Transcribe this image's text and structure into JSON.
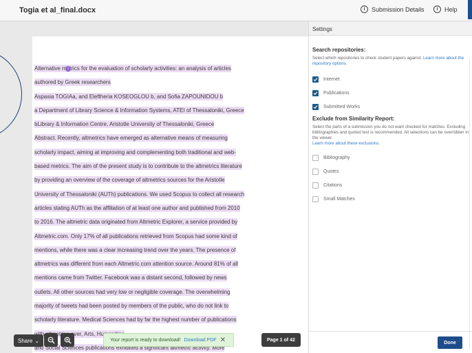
{
  "header": {
    "doc_title": "Togia et al_final.docx",
    "submission_details": "Submission Details",
    "help": "Help"
  },
  "document": {
    "marker": "1",
    "lines": [
      "Alternative metrics for the evaluation of scholarly activities: an analysis of articles",
      "authored by Greek researchers",
      "Aspasia TOGIAa, and Eleftheria KOSEOGLOU b, and Sofia ZAPOUNIDOU b",
      "a Department of Library Science & Information Systems, ATEI of Thessaloniki, Greece",
      "bLibrary & Information Centre, Aristotle University of Thessaloniki, Greece",
      "Abstract. Recently, altmetrics have emerged as alternative means of measuring",
      "scholarly impact, aiming at improving and complementing both traditional and web-",
      "based metrics. The aim of the present study is to contribute to the altmetrics literature",
      "by providing an overview of the coverage of altmetrics sources for the Aristotle",
      "University of Thessaloniki (AUTh) publications. We used Scopus to collect all research",
      "articles stating AUTh as the affiliation of at least one author and published from 2010",
      "to 2016. The altmetric data originated from Altmetric Explorer, a service provided by",
      "Altmetric.com. Only 17% of all publications retrieved from Scopus had some kind of",
      "mentions, while there was a clear increasing trend over the years. The presence of",
      "altmetrics was different from each Altmetric.com attention source. Around 81% of all",
      "mentions came from Twitter. Facebook was a distant second, followed by news",
      "outlets. All other sources had very low or negligible coverage. The overwhelming",
      "majority of tweets had been posted by members of the public, who do not link to",
      "scholarly literature. Medical Sciences had by far the highest number of publications",
      "with altmetrics                                                                        ever, Arts, Humanities",
      "and Social Sciences publications exhibited a significant altmetric activity. More"
    ]
  },
  "toolbar": {
    "share": "Share",
    "toast_text": "Your report is ready to download!",
    "download_pdf": "Download PDF",
    "toast_close": "✕",
    "page_count": "Page 1 of 42"
  },
  "settings": {
    "header": "Settings",
    "search": {
      "title": "Search repositories:",
      "desc": "Select which repositories to check student papers against.",
      "learn_more": "Learn more about the repository options.",
      "options": [
        {
          "label": "Internet",
          "checked": true
        },
        {
          "label": "Publications",
          "checked": true
        },
        {
          "label": "Submitted Works",
          "checked": true
        }
      ]
    },
    "exclude": {
      "title": "Exclude from Similarity Report:",
      "desc": "Select the parts of a submission you do not want checked for matches. Excluding bibliographies and quoted text is recommended. All selections can be overridden in the viewer.",
      "learn_more": "Learn more about these exclusions.",
      "options": [
        {
          "label": "Bibliography",
          "checked": false
        },
        {
          "label": "Quotes",
          "checked": false
        },
        {
          "label": "Citations",
          "checked": false
        },
        {
          "label": "Small Matches",
          "checked": false
        }
      ]
    },
    "done": "Done"
  }
}
